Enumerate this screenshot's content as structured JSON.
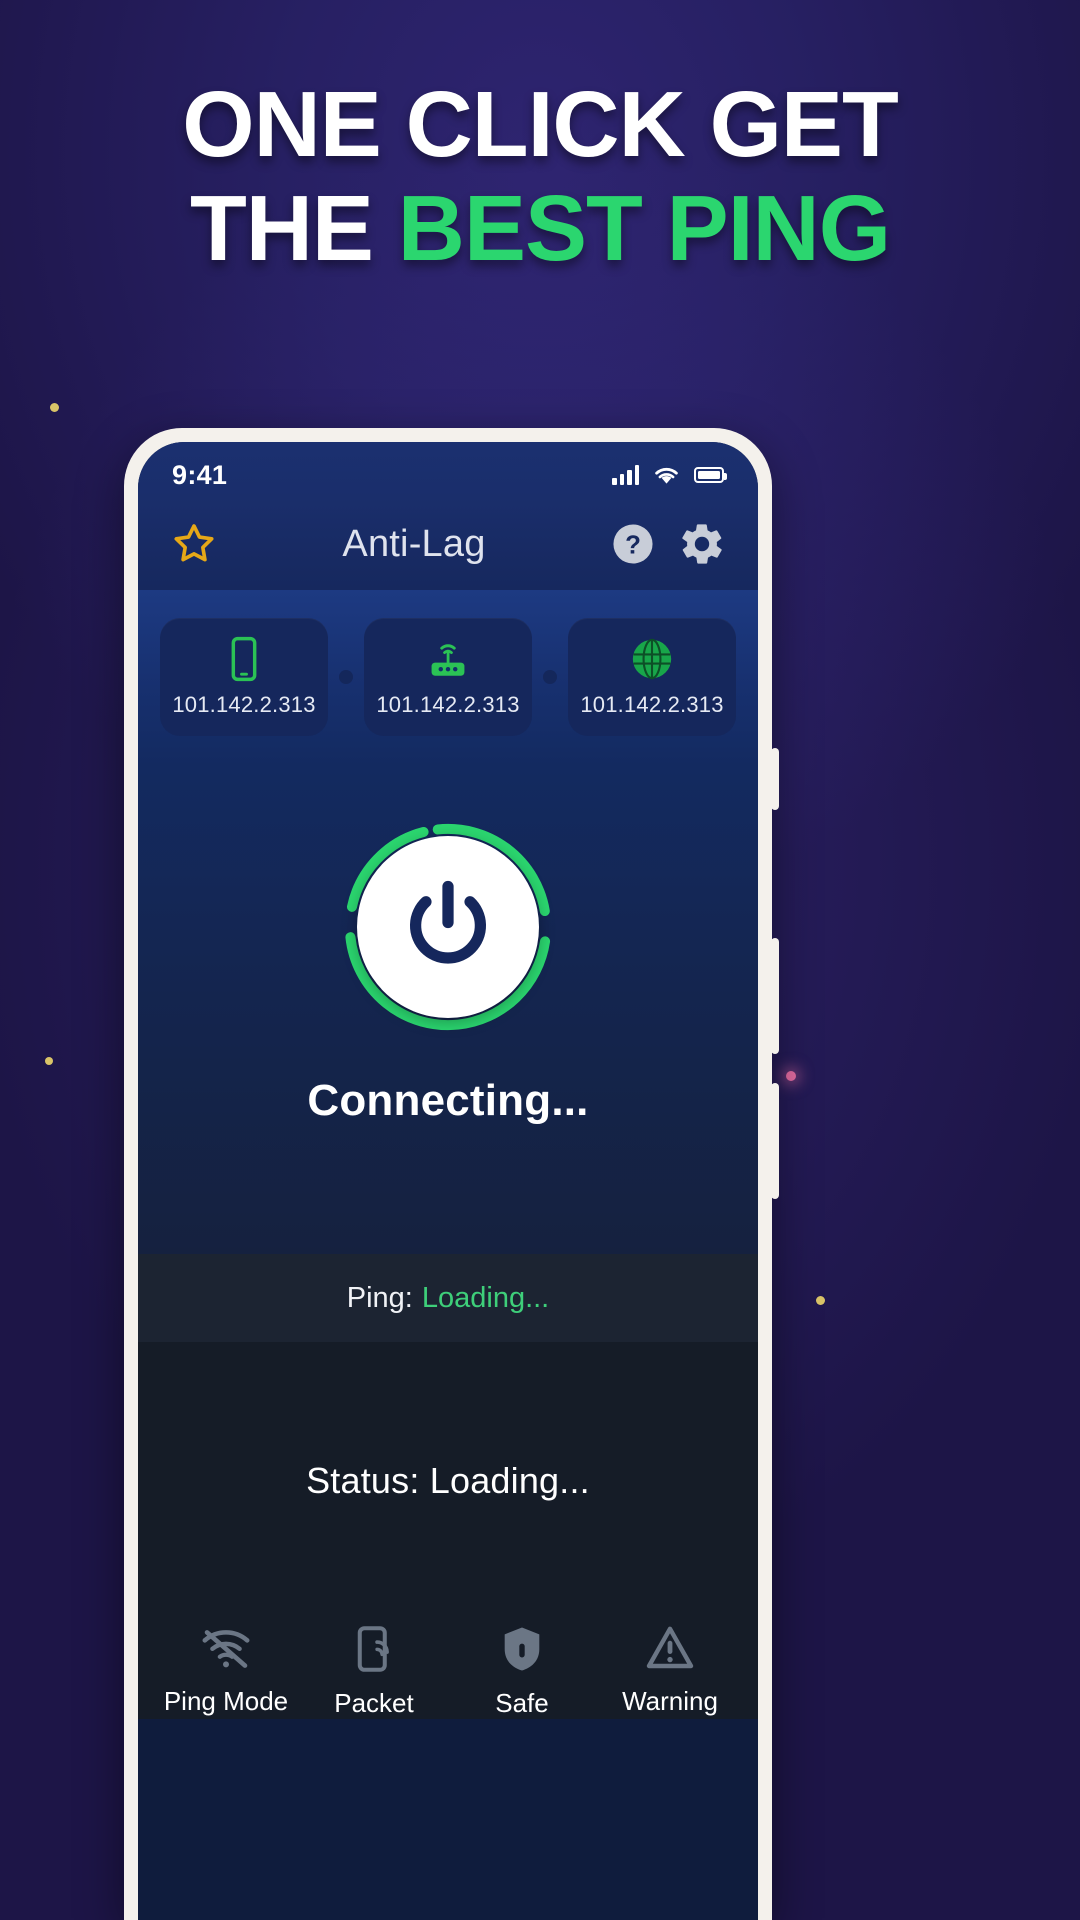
{
  "promo": {
    "line1": "ONE CLICK GET",
    "line2_white": "THE ",
    "line2_green": "BEST PING",
    "colors": {
      "white": "#ffffff",
      "green": "#2bd66f",
      "bg_purple": "#241d5c"
    }
  },
  "phone": {
    "statusbar": {
      "time": "9:41",
      "icons": [
        "signal-icon",
        "wifi-icon",
        "battery-icon"
      ]
    },
    "appbar": {
      "title": "Anti-Lag",
      "star_icon": "star-icon",
      "help_icon": "help-icon",
      "settings_icon": "gear-icon"
    },
    "chips": [
      {
        "icon": "mobile-phone-icon",
        "ip": "101.142.2.313"
      },
      {
        "icon": "router-icon",
        "ip": "101.142.2.313"
      },
      {
        "icon": "globe-icon",
        "ip": "101.142.2.313"
      }
    ],
    "power": {
      "icon": "power-icon",
      "ring_color": "#2bd66f",
      "core_color": "#ffffff",
      "glyph_color": "#15275c",
      "state_label": "Connecting..."
    },
    "ping": {
      "label": "Ping:",
      "value": "Loading...",
      "value_color": "#3ecf7a"
    },
    "status": {
      "text": "Status: Loading..."
    },
    "bottom_nav": [
      {
        "icon": "wifi-off-icon",
        "label": "Ping Mode"
      },
      {
        "icon": "packet-icon",
        "label": "Packet"
      },
      {
        "icon": "shield-icon",
        "label": "Safe"
      },
      {
        "icon": "warning-icon",
        "label": "Warning"
      }
    ]
  }
}
